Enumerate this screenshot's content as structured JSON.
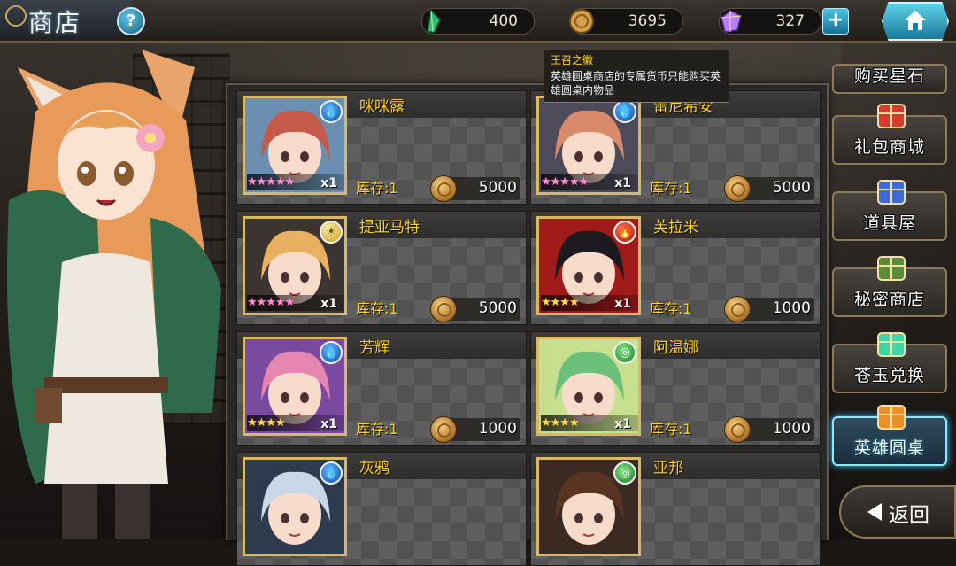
{
  "header": {
    "title": "商店",
    "help_label": "?",
    "currencies": [
      {
        "name": "green-crystal",
        "value": "400",
        "color": "#2fbf6a"
      },
      {
        "name": "gold-coin",
        "value": "3695",
        "color": "#d6a04a"
      },
      {
        "name": "rainbow-gem",
        "value": "327",
        "color": "#b87cff"
      }
    ],
    "plus_label": "+"
  },
  "tooltip": {
    "title": "王召之徽",
    "body": "英雄圆桌商店的专属货币只能购买英雄圆桌内物品"
  },
  "shop": {
    "stock_label": "库存:1",
    "quantity_label": "x1",
    "items": [
      {
        "name": "咪咪露",
        "element": "water-icon",
        "element_glyph": "💧",
        "rarity": 5,
        "stars": "★★★★★",
        "price": "5000",
        "hair": "#c65a4a",
        "accent": "#6a8fb0"
      },
      {
        "name": "雷尼希安",
        "element": "water-icon",
        "element_glyph": "💧",
        "rarity": 5,
        "stars": "★★★★★",
        "price": "5000",
        "hair": "#d98a6a",
        "accent": "#4d4a5a"
      },
      {
        "name": "提亚马特",
        "element": "light-icon",
        "element_glyph": "☀",
        "rarity": 5,
        "stars": "★★★★★",
        "price": "5000",
        "hair": "#e8b060",
        "accent": "#3b3430"
      },
      {
        "name": "芙拉米",
        "element": "fire-icon",
        "element_glyph": "🔥",
        "rarity": 4,
        "stars": "★★★★",
        "price": "1000",
        "hair": "#1c1a1e",
        "accent": "#a01a1a"
      },
      {
        "name": "芳辉",
        "element": "water-icon",
        "element_glyph": "💧",
        "rarity": 4,
        "stars": "★★★★",
        "price": "1000",
        "hair": "#e586b0",
        "accent": "#7a4aa0"
      },
      {
        "name": "阿温娜",
        "element": "wind-icon",
        "element_glyph": "◎",
        "rarity": 4,
        "stars": "★★★★",
        "price": "1000",
        "hair": "#6cc07a",
        "accent": "#c7e090"
      },
      {
        "name": "灰鸦",
        "element": "water-icon",
        "element_glyph": "💧",
        "rarity": 4,
        "stars": "",
        "price": "",
        "hair": "#c8d8e8",
        "accent": "#2e3a4e"
      },
      {
        "name": "亚邦",
        "element": "wind-icon",
        "element_glyph": "◎",
        "rarity": 4,
        "stars": "",
        "price": "",
        "hair": "#5a3422",
        "accent": "#3a2a22"
      }
    ]
  },
  "menu": [
    {
      "label": "购买星石",
      "icon": "star-stone-icon",
      "active": false
    },
    {
      "label": "礼包商城",
      "icon": "gift-box-icon",
      "active": false
    },
    {
      "label": "道具屋",
      "icon": "potion-icon",
      "active": false
    },
    {
      "label": "秘密商店",
      "icon": "treasure-bag-icon",
      "active": false
    },
    {
      "label": "苍玉兑换",
      "icon": "jade-crystal-icon",
      "active": false
    },
    {
      "label": "英雄圆桌",
      "icon": "hero-cards-icon",
      "active": true
    }
  ],
  "back_label": "返回"
}
